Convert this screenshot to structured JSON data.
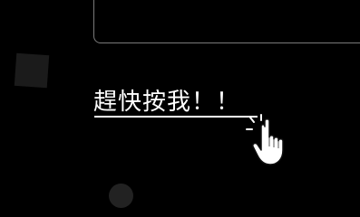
{
  "cta": {
    "label": "趕快按我！！"
  },
  "icons": {
    "pointer": "pointing-hand-icon"
  },
  "colors": {
    "background": "#000000",
    "text": "#ffffff",
    "panel_border": "#7a7a7a",
    "decor": "#1b1b1b"
  }
}
